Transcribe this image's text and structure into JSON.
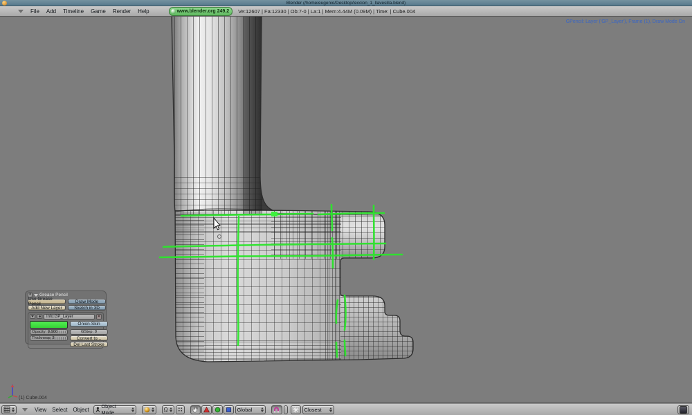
{
  "window": {
    "title": "Blender (/home/eugenio/Desktop/leccion_1_llavesilla.blend)"
  },
  "top_header": {
    "menus": [
      "File",
      "Add",
      "Timeline",
      "Game",
      "Render",
      "Help"
    ],
    "version_badge": "www.blender.org 249.2",
    "stats": "Ve:12607 | Fa:12330 | Ob:7-0 | La:1 | Mem:4.44M (0.09M) | Time: | Cube.004"
  },
  "viewport": {
    "status_text": "GPencil: Layer ('GP_Layer'), Frame (1), Draw Mode On",
    "object_label": "(1) Cube.004"
  },
  "gp_panel": {
    "title": "Grease Pencil",
    "use_gp": "Use Grease Pencil",
    "draw_mode": "Draw Mode",
    "add_layer": "Add New Layer",
    "sketch3d": "Sketch in 3D",
    "layer_name": "Info:GP_Layer",
    "onion": "Onion-Skin",
    "opacity": "Opacity: 0.900",
    "gstep": "GStep: 0",
    "thickness": "Thickness: 3",
    "convert": "Convert to...",
    "del_stroke": "Del Last Stroke"
  },
  "bottom_header": {
    "menus": [
      "View",
      "Select",
      "Object"
    ],
    "mode": "Object Mode",
    "orientation": "Global",
    "snap_target": "Closest"
  },
  "colors": {
    "gp_stroke": "#2ce52c",
    "status_text": "#3a66c4",
    "badge_green": "#6fc46f",
    "titlebar": "#63869a",
    "viewport_bg": "#7d7d7d"
  }
}
